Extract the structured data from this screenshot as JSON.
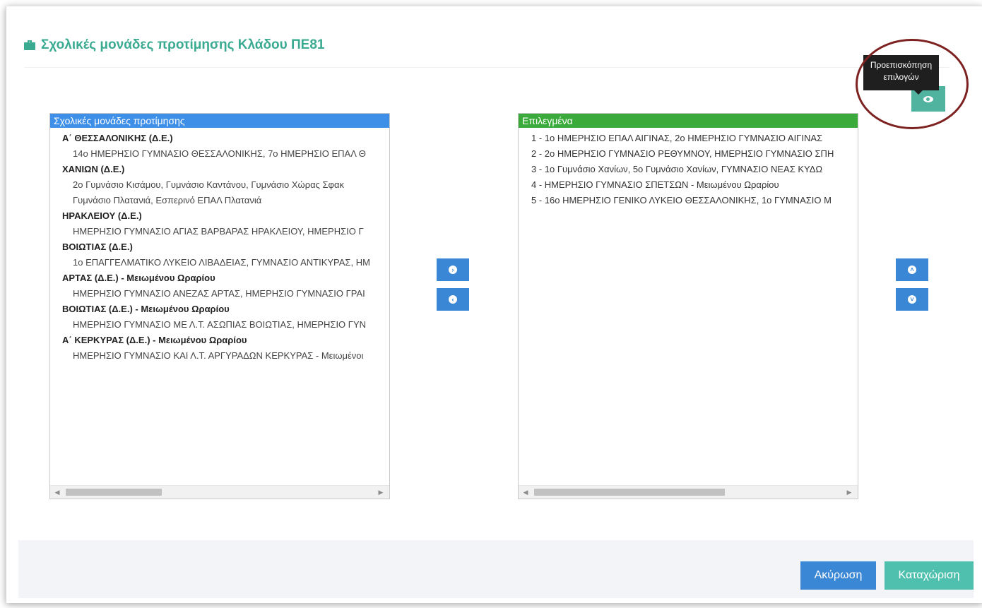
{
  "title": "Σχολικές μονάδες προτίμησης Κλάδου ΠΕ81",
  "colors": {
    "accent_teal": "#3aaa91",
    "available_header": "#3d8fe8",
    "selected_header": "#3aaa3a",
    "primary_blue": "#3a87d6",
    "submit_teal": "#4fc0ae",
    "highlight_ring": "#7d2121"
  },
  "available": {
    "header": "Σχολικές μονάδες προτίμησης",
    "groups": [
      {
        "title": "Α΄ ΘΕΣΣΑΛΟΝΙΚΗΣ (Δ.Ε.)",
        "items": [
          "14ο ΗΜΕΡΗΣΙΟ ΓΥΜΝΑΣΙΟ ΘΕΣΣΑΛΟΝΙΚΗΣ, 7ο ΗΜΕΡΗΣΙΟ ΕΠΑΛ Θ"
        ]
      },
      {
        "title": "ΧΑΝΙΩΝ (Δ.Ε.)",
        "items": [
          "2ο Γυμνάσιο Κισάμου, Γυμνάσιο Καντάνου, Γυμνάσιο Χώρας Σφακ",
          "Γυμνάσιο Πλατανιά, Εσπερινό ΕΠΑΛ Πλατανιά"
        ]
      },
      {
        "title": "ΗΡΑΚΛΕΙΟΥ (Δ.Ε.)",
        "items": [
          "ΗΜΕΡΗΣΙΟ ΓΥΜΝΑΣΙΟ ΑΓΙΑΣ ΒΑΡΒΑΡΑΣ ΗΡΑΚΛΕΙΟΥ, ΗΜΕΡΗΣΙΟ Γ"
        ]
      },
      {
        "title": "ΒΟΙΩΤΙΑΣ (Δ.Ε.)",
        "items": [
          "1ο ΕΠΑΓΓΕΛΜΑΤΙΚΟ ΛΥΚΕΙΟ ΛΙΒΑΔΕΙΑΣ, ΓΥΜΝΑΣΙΟ ΑΝΤΙΚΥΡΑΣ, ΗΜ"
        ]
      },
      {
        "title": "ΑΡΤΑΣ (Δ.Ε.) - Μειωμένου Ωραρίου",
        "items": [
          "ΗΜΕΡΗΣΙΟ ΓΥΜΝΑΣΙΟ ΑΝΕΖΑΣ ΑΡΤΑΣ, ΗΜΕΡΗΣΙΟ ΓΥΜΝΑΣΙΟ ΓΡΑΙ"
        ]
      },
      {
        "title": "ΒΟΙΩΤΙΑΣ (Δ.Ε.) - Μειωμένου Ωραρίου",
        "items": [
          "ΗΜΕΡΗΣΙΟ ΓΥΜΝΑΣΙΟ ΜΕ Λ.Τ. ΑΣΩΠΙΑΣ ΒΟΙΩΤΙΑΣ, ΗΜΕΡΗΣΙΟ ΓΥΝ"
        ]
      },
      {
        "title": "Α΄ ΚΕΡΚΥΡΑΣ (Δ.Ε.) - Μειωμένου Ωραρίου",
        "items": [
          "ΗΜΕΡΗΣΙΟ ΓΥΜΝΑΣΙΟ ΚΑΙ Λ.Τ. ΑΡΓΥΡΑΔΩΝ ΚΕΡΚΥΡΑΣ - Μειωμένοι"
        ]
      }
    ]
  },
  "selected": {
    "header": "Επιλεγμένα",
    "items": [
      "1 - 1ο ΗΜΕΡΗΣΙΟ ΕΠΑΛ ΑΙΓΙΝΑΣ, 2ο ΗΜΕΡΗΣΙΟ ΓΥΜΝΑΣΙΟ ΑΙΓΙΝΑΣ",
      "2 - 2ο ΗΜΕΡΗΣΙΟ ΓΥΜΝΑΣΙΟ ΡΕΘΥΜΝΟΥ, ΗΜΕΡΗΣΙΟ ΓΥΜΝΑΣΙΟ ΣΠΗ",
      "3 - 1ο Γυμνάσιο Χανίων, 5ο Γυμνάσιο Χανίων, ΓΥΜΝΑΣΙΟ ΝΕΑΣ ΚΥΔΩ",
      "4 - ΗΜΕΡΗΣΙΟ ΓΥΜΝΑΣΙΟ ΣΠΕΤΣΩΝ - Μειωμένου Ωραρίου",
      "5 - 16ο ΗΜΕΡΗΣΙΟ ΓΕΝΙΚΟ ΛΥΚΕΙΟ ΘΕΣΣΑΛΟΝΙΚΗΣ, 1ο ΓΥΜΝΑΣΙΟ Μ"
    ]
  },
  "tooltip": "Προεπισκόπηση επιλογών",
  "icons": {
    "title": "briefcase-icon",
    "move_right": "chevron-circle-right-icon",
    "move_left": "chevron-circle-left-icon",
    "move_up": "chevron-circle-up-icon",
    "move_down": "chevron-circle-down-icon",
    "preview": "eye-icon"
  },
  "glyphs": {
    "right": "›",
    "left": "‹",
    "up": "˄",
    "down": "˅",
    "scroll_left": "◀",
    "scroll_right": "▶"
  },
  "buttons": {
    "cancel": "Ακύρωση",
    "submit": "Καταχώριση"
  }
}
